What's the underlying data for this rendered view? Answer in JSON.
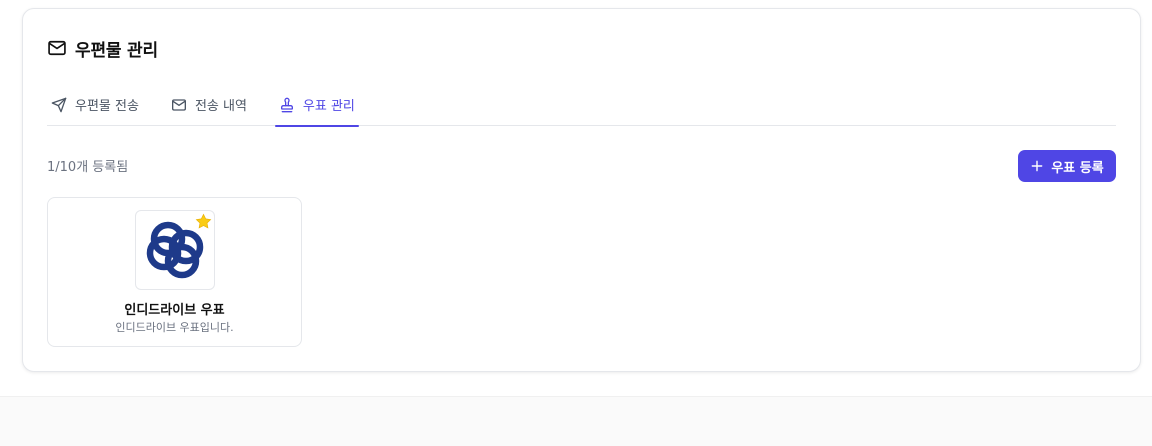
{
  "panel": {
    "title": "우편물 관리",
    "title_icon": "mail-icon"
  },
  "tabs": [
    {
      "label": "우편물 전송",
      "icon": "send-icon",
      "active": false
    },
    {
      "label": "전송 내역",
      "icon": "mail-icon",
      "active": false
    },
    {
      "label": "우표 관리",
      "icon": "stamp-icon",
      "active": true
    }
  ],
  "stamps": {
    "count_label": "1/10개 등록됨",
    "add_button_label": "우표 등록",
    "items": [
      {
        "name": "인디드라이브 우표",
        "description": "인디드라이브 우표입니다.",
        "starred": true
      }
    ]
  },
  "colors": {
    "accent": "#4f46e5",
    "star": "#facc15",
    "logo": "#1e3a8a"
  }
}
